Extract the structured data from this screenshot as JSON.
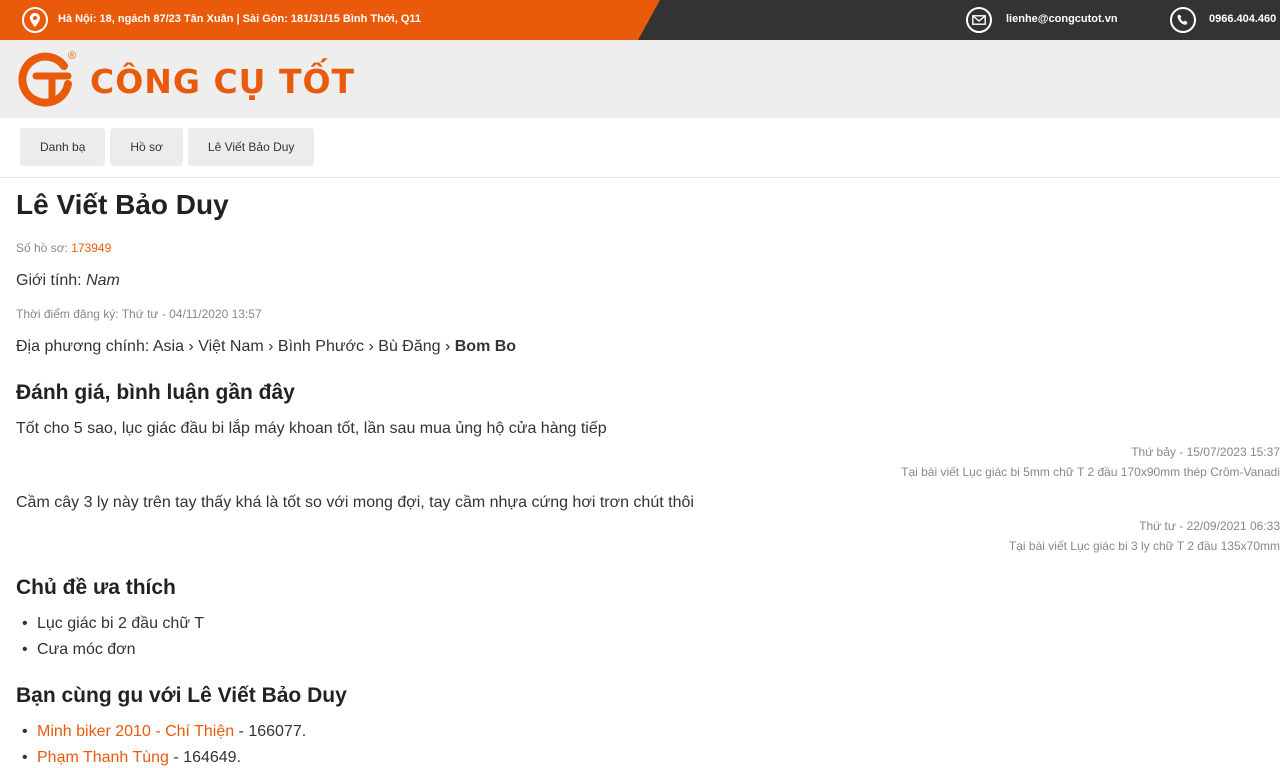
{
  "topbar": {
    "address": "Hà Nội: 18, ngách 87/23 Tân Xuân | Sài Gòn: 181/31/15 Bình Thới, Q11",
    "email": "lienhe@congcutot.vn",
    "phone": "0966.404.460"
  },
  "logo": {
    "text": "CÔNG CỤ TỐT",
    "reg": "®",
    "brand_color": "#ea5a0b"
  },
  "breadcrumb": [
    "Danh bạ",
    "Hồ sơ",
    "Lê Viết Bảo Duy"
  ],
  "profile": {
    "name": "Lê Viết Bảo Duy",
    "id_label": "Số hồ sơ: ",
    "id_value": "173949",
    "gender_label": "Giới tính: ",
    "gender_value": "Nam",
    "registered": "Thời điểm đăng ký: Thứ tư - 04/11/2020 13:57",
    "location_label": "Địa phương chính: Asia › Việt Nam › Bình Phước › Bù Đăng › ",
    "location_last": "Bom Bo"
  },
  "reviews": {
    "heading": "Đánh giá, bình luận gần đây",
    "items": [
      {
        "text": "Tốt cho 5 sao, lục giác đầu bi lắp máy khoan tốt, lần sau mua ủng hộ cửa hàng tiếp",
        "date": "Thứ bảy - 15/07/2023 15:37",
        "post": "Tại bài viết Lục giác bi 5mm chữ T 2 đầu 170x90mm thép Crôm-Vanadi"
      },
      {
        "text": "Cầm cây 3 ly này trên tay thấy khá là tốt so với mong đợi, tay cầm nhựa cứng hơi trơn chút thôi",
        "date": "Thứ tư - 22/09/2021 06:33",
        "post": "Tại bài viết Lục giác bi 3 ly chữ T 2 đầu 135x70mm"
      }
    ]
  },
  "favorites": {
    "heading": "Chủ đề ưa thích",
    "items": [
      "Lục giác bi 2 đầu chữ T",
      "Cưa móc đơn"
    ]
  },
  "similar": {
    "heading": "Bạn cùng gu với Lê Viết Bảo Duy",
    "items": [
      {
        "name": "Minh biker 2010 - Chí Thiện",
        "id": " - 166077."
      },
      {
        "name": "Phạm Thanh Tùng",
        "id": " - 164649."
      }
    ]
  }
}
